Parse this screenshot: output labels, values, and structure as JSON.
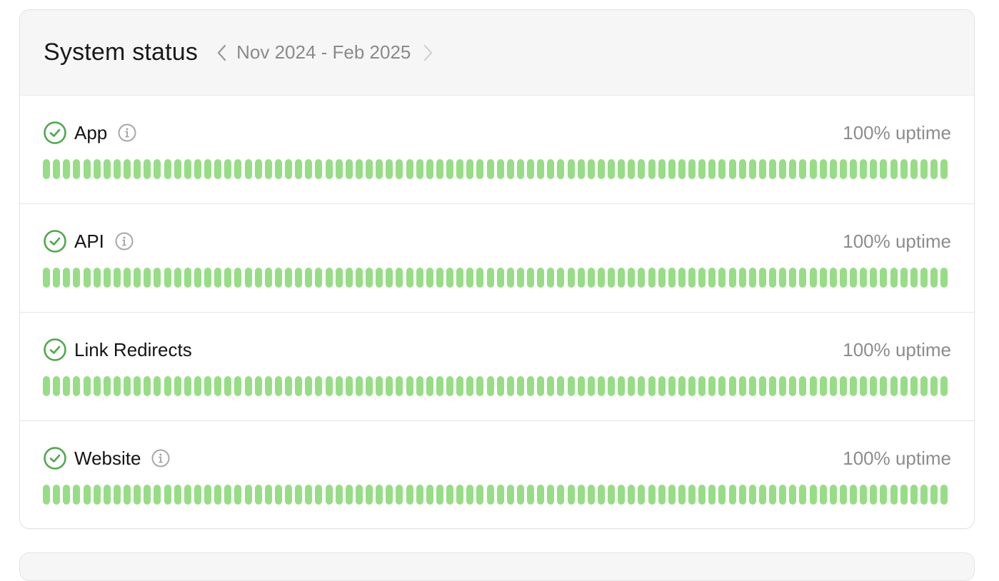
{
  "header": {
    "title": "System status",
    "period_label": "Nov 2024 - Feb 2025",
    "prev_icon": "chevron-left-icon",
    "next_icon": "chevron-right-icon"
  },
  "colors": {
    "bar_up": "#97dd86",
    "status_ok": "#4fa84a",
    "info_icon": "#a8a8a8"
  },
  "bars_per_service": 90,
  "services": [
    {
      "name": "App",
      "uptime_label": "100% uptime",
      "status": "operational",
      "status_icon": "check-circle-icon",
      "has_info": true
    },
    {
      "name": "API",
      "uptime_label": "100% uptime",
      "status": "operational",
      "status_icon": "check-circle-icon",
      "has_info": true
    },
    {
      "name": "Link Redirects",
      "uptime_label": "100% uptime",
      "status": "operational",
      "status_icon": "check-circle-icon",
      "has_info": false
    },
    {
      "name": "Website",
      "uptime_label": "100% uptime",
      "status": "operational",
      "status_icon": "check-circle-icon",
      "has_info": true
    }
  ]
}
